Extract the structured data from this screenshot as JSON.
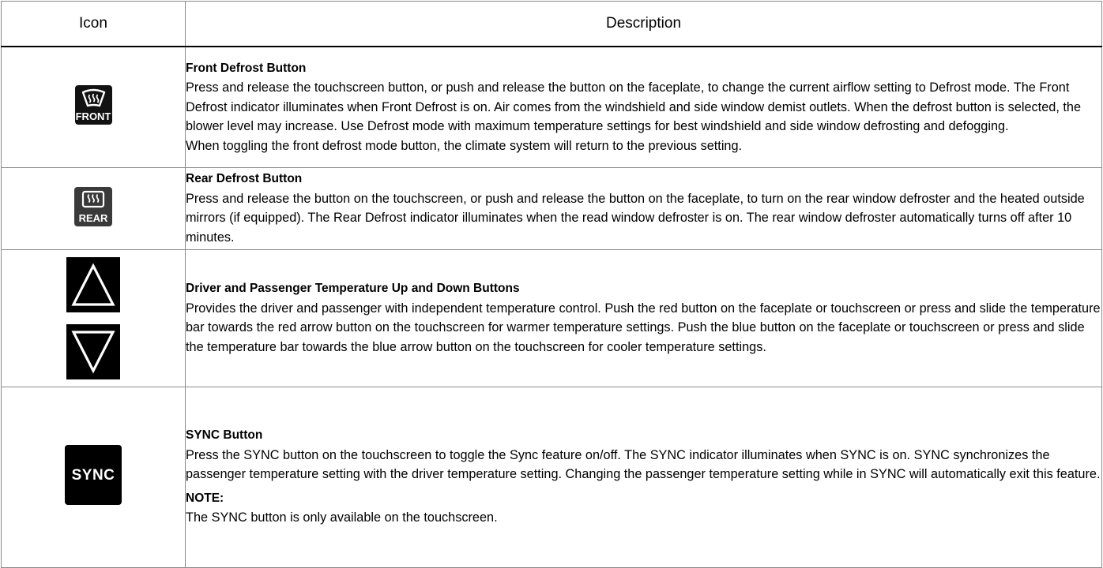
{
  "headers": {
    "icon": "Icon",
    "description": "Description"
  },
  "rows": [
    {
      "icon_name": "front-defrost-icon",
      "icon_caption": "FRONT",
      "title": "Front Defrost Button",
      "paragraphs": [
        "Press and release the touchscreen button, or push and release the button on the faceplate, to change the current airflow setting to Defrost mode. The Front Defrost indicator illuminates when Front Defrost is on. Air comes from the windshield and side window demist outlets. When the defrost button is selected, the blower level may increase. Use Defrost mode with maximum temperature settings for best windshield and side window defrosting and defogging.",
        "When toggling the front defrost mode button, the climate system will return to the previous setting."
      ]
    },
    {
      "icon_name": "rear-defrost-icon",
      "icon_caption": "REAR",
      "title": "Rear Defrost Button",
      "paragraphs": [
        "Press and release the button on the touchscreen, or push and release the button on the faceplate, to turn on the rear window defroster and the heated outside mirrors (if equipped). The Rear Defrost indicator illuminates when the read window defroster is on. The rear window defroster automatically turns off after 10 minutes."
      ]
    },
    {
      "icon_names": [
        "temperature-up-icon",
        "temperature-down-icon"
      ],
      "title": "Driver and Passenger Temperature Up and Down Buttons",
      "paragraphs": [
        "Provides the driver and passenger with independent temperature control. Push the red button on the faceplate or touchscreen or press and slide the temperature bar towards the red arrow button on the touchscreen for warmer temperature settings. Push the blue button on the faceplate or touchscreen or press and slide the temperature bar towards the blue arrow button on the touchscreen for cooler temperature settings."
      ]
    },
    {
      "icon_name": "sync-icon",
      "icon_caption": "SYNC",
      "title": "SYNC Button",
      "paragraphs": [
        "Press the SYNC button on the touchscreen to toggle the Sync feature on/off. The SYNC indicator illuminates when SYNC is on. SYNC synchronizes the passenger temperature setting with the driver temperature setting. Changing the passenger temperature setting while in SYNC will automatically exit this feature."
      ],
      "note_title": "NOTE:",
      "note_text": "The SYNC button is only available on the touchscreen."
    }
  ]
}
